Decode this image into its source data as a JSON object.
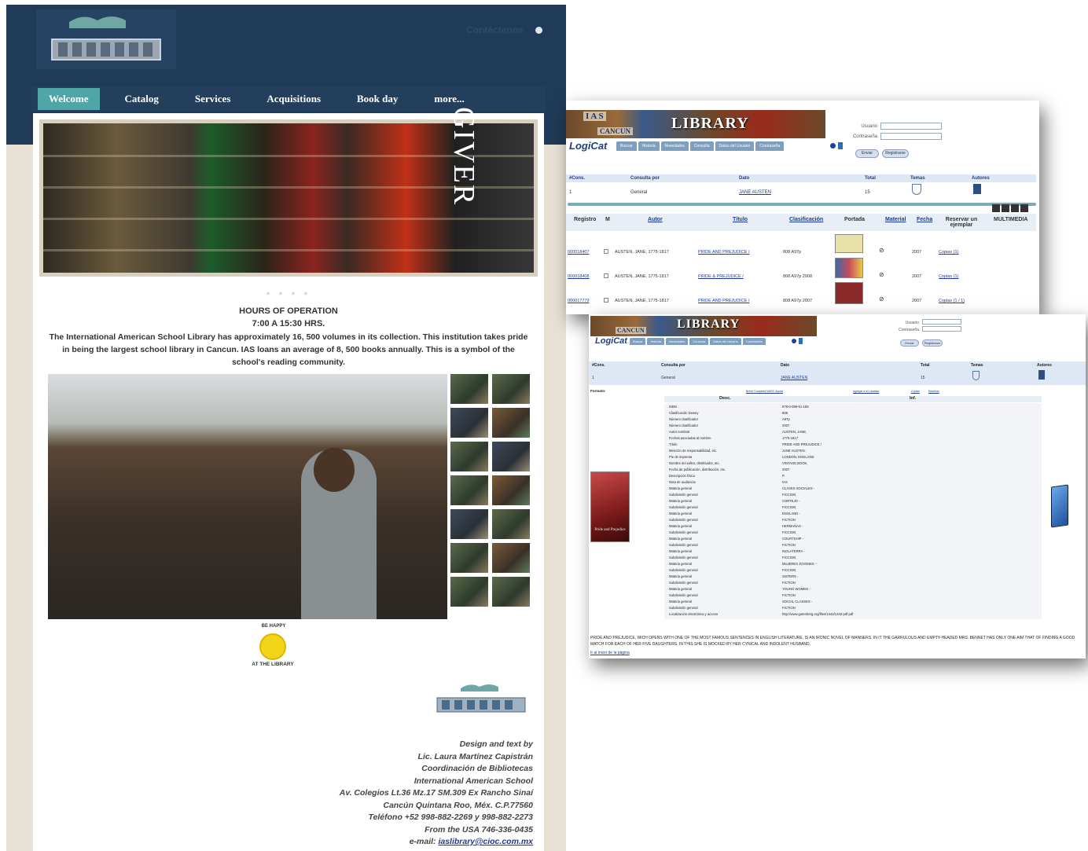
{
  "site": {
    "contact": "Contáctenos",
    "nav": [
      "Welcome",
      "Catalog",
      "Services",
      "Acquisitions",
      "Book day",
      "more..."
    ],
    "hours_title": "HOURS OF OPERATION",
    "hours_time": "7:00 A 15:30 HRS.",
    "intro": "The International American School Library has approximately 16, 500 volumes in its collection. This institution takes pride in being the largest school library in Cancun. IAS loans an average of 8, 500 books annually. This is a symbol of the school's reading community.",
    "banner_text": "GIVER",
    "smiley_top": "BE HAPPY",
    "smiley_bottom": "AT THE LIBRARY",
    "credits": [
      "Design and text by",
      "Lic. Laura Martínez Capistrán",
      "Coordinación de Bibliotecas",
      "International American School",
      "Av. Colegios Lt.36 Mz.17  SM.309 Ex Rancho Sinaí",
      "Cancún Quintana Roo, Méx. C.P.77560",
      "Teléfono +52 998-882-2269 y 998-882-2273",
      "From the USA 746-336-0435"
    ],
    "email_label": "e-mail: ",
    "email": "iaslibrary@cioc.com.mx"
  },
  "w1": {
    "banner_ias": "I A S",
    "banner_cancun": "CANCUN",
    "banner_title": "LIBRARY",
    "logicat": "LogiCat",
    "tabs": [
      "Buscar",
      "Historia",
      "Novedades",
      "Consulta",
      "Datos del Usuario",
      "Contraseña"
    ],
    "login": {
      "user_label": "Usuario",
      "pass_label": "Contraseña",
      "enter": "Enviar",
      "register": "Registrarse"
    },
    "summary_headers": [
      "#Cons.",
      "Consulta por",
      "Dato",
      "Total",
      "Temas",
      "Autores"
    ],
    "summary_row": {
      "cons": "1",
      "consulta": "General",
      "dato": "JANE AUSTEN",
      "total": "15"
    },
    "grid_headers": [
      "Registro",
      "M",
      "Autor",
      "Título",
      "Clasificación",
      "Portada",
      "Material",
      "Fecha",
      "Reservar un ejemplar",
      "MULTIMEDIA"
    ],
    "rows": [
      {
        "registro": "000018407",
        "autor": "AUSTEN, JANE, 1775-1817",
        "titulo": "PRIDE AND PREJUDICE /",
        "clasif": "808 A97p",
        "fecha": "2007",
        "copias": "Copias (1)"
      },
      {
        "registro": "000018408",
        "autor": "AUSTEN, JANE, 1775-1817",
        "titulo": "PRIDE & PREJUDICE /",
        "clasif": "808 A97p 2008",
        "fecha": "2007",
        "copias": "Copias (1)"
      },
      {
        "registro": "000017779",
        "autor": "AUSTEN, JANE, 1775-1817",
        "titulo": "PRIDE AND PREJUDICE /",
        "clasif": "808 A97p 2007",
        "fecha": "2007",
        "copias": "Copias (1 / 1)"
      }
    ]
  },
  "w2": {
    "banner_cancun": "CANCUN",
    "banner_title": "LIBRARY",
    "logicat": "LogiCat",
    "tabs": [
      "Buscar",
      "Historia",
      "Novedades",
      "Consulta",
      "Datos del Usuario",
      "Contraseña"
    ],
    "login": {
      "user_label": "Usuario",
      "pass_label": "Contraseña",
      "enter": "Enviar",
      "register": "Registrarse"
    },
    "summary_headers": [
      "#Cons.",
      "Consulta por",
      "Dato",
      "Total",
      "Temas",
      "Autores"
    ],
    "summary_row": {
      "cons": "1",
      "consulta": "General",
      "dato": "JANE AUSTEN",
      "total": "15"
    },
    "formato_label": "Formato:",
    "formato_opts": "Breve  Completa  MARC  Ayuda",
    "mid_link": "Agregar a mi canasta",
    "right_links": [
      "Copias",
      "Reseñas"
    ],
    "col_desc": "Desc.",
    "col_inf": "Inf.",
    "cover_title": "Pride and Prejudice",
    "record": [
      [
        "ISBN",
        "978-0-099-51-159"
      ],
      [
        "Clasificación Dewey",
        "808"
      ],
      [
        "Número clasificador",
        "A97p"
      ],
      [
        "Número clasificador",
        "2007"
      ],
      [
        "Autor nombral",
        "AUSTEN, JANE,"
      ],
      [
        "Fechas asociadas al nombre",
        "1775-1817"
      ],
      [
        "Título",
        "PRIDE AND PREJUDICE /"
      ],
      [
        "Mención de responsabilidad, etc.",
        "JANE AUSTEN."
      ],
      [
        "Pie de imprenta",
        "LONDON, ENGLAND"
      ],
      [
        "Nombre del editor, distribuidor, etc.",
        "VINTAGE BOOK,"
      ],
      [
        "Fecha de publicación, distribución, etc.",
        "2007"
      ],
      [
        "Descripción física",
        "P."
      ],
      [
        "Nota de audiencia",
        "IAS"
      ],
      [
        "Materia general",
        "CLASES SOCIALES -"
      ],
      [
        "Subdivisión general",
        "FICCION"
      ],
      [
        "Materia general",
        "CORTEJO -"
      ],
      [
        "Subdivisión general",
        "FICCION"
      ],
      [
        "Materia general",
        "ENGLAND -"
      ],
      [
        "Subdivisión general",
        "FICTION"
      ],
      [
        "Materia general",
        "HERMANAS -"
      ],
      [
        "Subdivisión general",
        "FICCION"
      ],
      [
        "Materia general",
        "COURTSHIP -"
      ],
      [
        "Subdivisión general",
        "FICTION"
      ],
      [
        "Materia general",
        "INGLATERRA -"
      ],
      [
        "Subdivisión general",
        "FICCION"
      ],
      [
        "Materia general",
        "MUJERES JOVENES -"
      ],
      [
        "Subdivisión general",
        "FICCION"
      ],
      [
        "Materia general",
        "SISTERS -"
      ],
      [
        "Subdivisión general",
        "FICTION"
      ],
      [
        "Materia general",
        "YOUNG WOMEN -"
      ],
      [
        "Subdivisión general",
        "FICTION"
      ],
      [
        "Materia general",
        "SOCIAL CLASSES -"
      ],
      [
        "Subdivisión general",
        "FICTION"
      ],
      [
        "Localización electrónica y acceso",
        "http://www.gutenberg.org/files/1342/1342-pdf.pdf"
      ]
    ],
    "summary_text": "PRIDE AND PREJUDICE, WICH OPENS WITH ONE OF THE MOST FAMOUS SENTENCES IN ENGLISH LITERATURE, IS AN IRONIC NOVEL OF MANNERS. IN IT THE GARRULOUS AND EMPTY-HEADED MRS. BENNET HAS ONLY ONE AIM THAT OF FINDING A GOOD MATCH FOR EACH OF HER FIVE DAUGHTERS. IN THIS SHE IS MOCKED BY HER CYNICAL AND INDOLENT HUSBAND.",
    "top_link": "Ir al inicio de la página"
  }
}
